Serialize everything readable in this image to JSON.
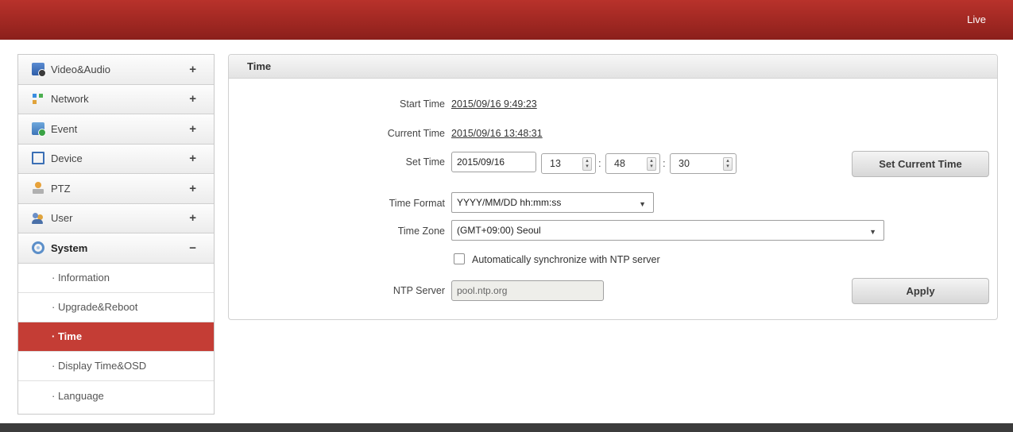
{
  "header": {
    "live_link": "Live"
  },
  "sidebar": {
    "items": [
      {
        "label": "Video&Audio",
        "toggle": "+",
        "icon": "video-audio-icon"
      },
      {
        "label": "Network",
        "toggle": "+",
        "icon": "network-icon"
      },
      {
        "label": "Event",
        "toggle": "+",
        "icon": "event-icon"
      },
      {
        "label": "Device",
        "toggle": "+",
        "icon": "device-icon"
      },
      {
        "label": "PTZ",
        "toggle": "+",
        "icon": "ptz-icon"
      },
      {
        "label": "User",
        "toggle": "+",
        "icon": "user-icon"
      },
      {
        "label": "System",
        "toggle": "−",
        "icon": "system-icon"
      }
    ],
    "system_subitems": [
      {
        "label": "· Information"
      },
      {
        "label": "· Upgrade&Reboot"
      },
      {
        "label": "· Time"
      },
      {
        "label": "· Display Time&OSD"
      },
      {
        "label": "· Language"
      }
    ],
    "selected_subitem": "Time"
  },
  "panel": {
    "title": "Time",
    "start_time_label": "Start Time",
    "start_time_value": "2015/09/16 9:49:23",
    "current_time_label": "Current Time",
    "current_time_value": "2015/09/16 13:48:31",
    "set_time_label": "Set Time",
    "set_time_date": "2015/09/16",
    "set_time_hour": "13",
    "set_time_minute": "48",
    "set_time_second": "30",
    "colon": ":",
    "set_current_time_button": "Set Current Time",
    "time_format_label": "Time Format",
    "time_format_value": "YYYY/MM/DD hh:mm:ss",
    "time_zone_label": "Time Zone",
    "time_zone_value": "(GMT+09:00) Seoul",
    "ntp_sync_label": "Automatically synchronize with NTP server",
    "ntp_sync_checked": false,
    "ntp_server_label": "NTP Server",
    "ntp_server_value": "pool.ntp.org",
    "apply_button": "Apply"
  },
  "colors": {
    "brand_red": "#9a2520",
    "selected_item": "#c43d35",
    "footer": "#3c3c3c"
  }
}
